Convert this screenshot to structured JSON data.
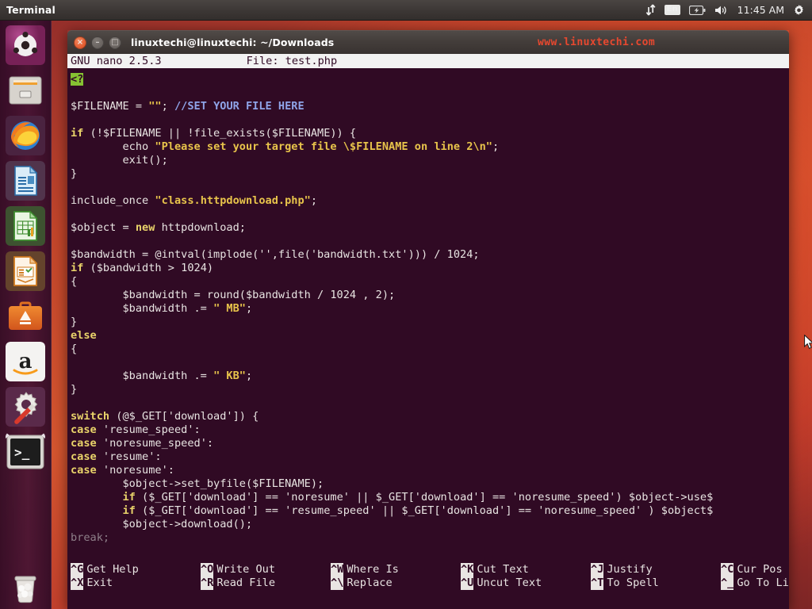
{
  "top_panel": {
    "app_title": "Terminal",
    "indicators": [
      {
        "name": "network-updown-icon",
        "label": "↕"
      },
      {
        "name": "keyboard-layout-indicator",
        "label": "En"
      },
      {
        "name": "battery-icon",
        "label": "battery"
      },
      {
        "name": "volume-icon",
        "label": "volume"
      },
      {
        "name": "clock-indicator",
        "label": "11:45 AM"
      },
      {
        "name": "system-menu-gear-icon",
        "label": "gear"
      }
    ],
    "clock": "11:45 AM",
    "keyboard_layout": "En"
  },
  "launcher": {
    "items": [
      {
        "name": "dash-home",
        "label": "Ubuntu Dash Home",
        "icon": "ubuntu-logo-icon",
        "running": false
      },
      {
        "name": "files",
        "label": "Files",
        "icon": "file-manager-icon",
        "running": false
      },
      {
        "name": "firefox",
        "label": "Firefox Web Browser",
        "icon": "firefox-icon",
        "running": false
      },
      {
        "name": "writer",
        "label": "LibreOffice Writer",
        "icon": "libreoffice-writer-icon",
        "running": false
      },
      {
        "name": "calc",
        "label": "LibreOffice Calc",
        "icon": "libreoffice-calc-icon",
        "running": false
      },
      {
        "name": "impress",
        "label": "LibreOffice Impress",
        "icon": "libreoffice-impress-icon",
        "running": false
      },
      {
        "name": "software-center",
        "label": "Ubuntu Software",
        "icon": "software-center-icon",
        "running": false
      },
      {
        "name": "amazon",
        "label": "Amazon",
        "icon": "amazon-icon",
        "running": false
      },
      {
        "name": "system-settings",
        "label": "System Settings",
        "icon": "system-settings-icon",
        "running": false
      },
      {
        "name": "terminal",
        "label": "Terminal",
        "icon": "terminal-icon",
        "running": true
      },
      {
        "name": "trash",
        "label": "Trash",
        "icon": "trash-icon",
        "running": false
      }
    ]
  },
  "window": {
    "title": "linuxtechi@linuxtechi: ~/Downloads",
    "watermark": "www.linuxtechi.com",
    "close_label": "×",
    "minimize_label": "–",
    "maximize_label": "□"
  },
  "nano": {
    "version": "GNU nano 2.5.3",
    "file_label": "File: test.php",
    "help": [
      [
        {
          "key": "^G",
          "label": "Get Help"
        },
        {
          "key": "^O",
          "label": "Write Out"
        },
        {
          "key": "^W",
          "label": "Where Is"
        },
        {
          "key": "^K",
          "label": "Cut Text"
        },
        {
          "key": "^J",
          "label": "Justify"
        },
        {
          "key": "^C",
          "label": "Cur Pos"
        }
      ],
      [
        {
          "key": "^X",
          "label": "Exit"
        },
        {
          "key": "^R",
          "label": "Read File"
        },
        {
          "key": "^\\",
          "label": "Replace"
        },
        {
          "key": "^U",
          "label": "Uncut Text"
        },
        {
          "key": "^T",
          "label": "To Spell"
        },
        {
          "key": "^_",
          "label": "Go To Line"
        }
      ]
    ]
  },
  "editor": {
    "lines": [
      [
        {
          "t": "<?",
          "c": "phptag"
        }
      ],
      [],
      [
        {
          "t": "$FILENAME = ",
          "c": "plain"
        },
        {
          "t": "\"\"",
          "c": "str"
        },
        {
          "t": "; ",
          "c": "plain"
        },
        {
          "t": "//SET YOUR FILE HERE",
          "c": "cmt"
        }
      ],
      [],
      [
        {
          "t": "if",
          "c": "kw"
        },
        {
          "t": " (!$FILENAME || !file_exists($FILENAME)) {",
          "c": "plain"
        }
      ],
      [
        {
          "t": "        echo ",
          "c": "plain"
        },
        {
          "t": "\"Please set your target file \\$FILENAME on line 2\\n\"",
          "c": "str"
        },
        {
          "t": ";",
          "c": "plain"
        }
      ],
      [
        {
          "t": "        exit();",
          "c": "plain"
        }
      ],
      [
        {
          "t": "}",
          "c": "plain"
        }
      ],
      [],
      [
        {
          "t": "include_once ",
          "c": "plain"
        },
        {
          "t": "\"class.httpdownload.php\"",
          "c": "str"
        },
        {
          "t": ";",
          "c": "plain"
        }
      ],
      [],
      [
        {
          "t": "$object = ",
          "c": "plain"
        },
        {
          "t": "new",
          "c": "kw"
        },
        {
          "t": " httpdownload;",
          "c": "plain"
        }
      ],
      [],
      [
        {
          "t": "$bandwidth = @intval(implode('',file('bandwidth.txt'))) / 1024;",
          "c": "plain"
        }
      ],
      [
        {
          "t": "if",
          "c": "kw"
        },
        {
          "t": " ($bandwidth > 1024)",
          "c": "plain"
        }
      ],
      [
        {
          "t": "{",
          "c": "plain"
        }
      ],
      [
        {
          "t": "        $bandwidth = round($bandwidth / 1024 , 2);",
          "c": "plain"
        }
      ],
      [
        {
          "t": "        $bandwidth .= ",
          "c": "plain"
        },
        {
          "t": "\" MB\"",
          "c": "str"
        },
        {
          "t": ";",
          "c": "plain"
        }
      ],
      [
        {
          "t": "}",
          "c": "plain"
        }
      ],
      [
        {
          "t": "else",
          "c": "kw"
        }
      ],
      [
        {
          "t": "{",
          "c": "plain"
        }
      ],
      [],
      [
        {
          "t": "        $bandwidth .= ",
          "c": "plain"
        },
        {
          "t": "\" KB\"",
          "c": "str"
        },
        {
          "t": ";",
          "c": "plain"
        }
      ],
      [
        {
          "t": "}",
          "c": "plain"
        }
      ],
      [],
      [
        {
          "t": "switch",
          "c": "kw"
        },
        {
          "t": " (@$_GET['download']) {",
          "c": "plain"
        }
      ],
      [
        {
          "t": "case",
          "c": "kw"
        },
        {
          "t": " 'resume_speed':",
          "c": "plain"
        }
      ],
      [
        {
          "t": "case",
          "c": "kw"
        },
        {
          "t": " 'noresume_speed':",
          "c": "plain"
        }
      ],
      [
        {
          "t": "case",
          "c": "kw"
        },
        {
          "t": " 'resume':",
          "c": "plain"
        }
      ],
      [
        {
          "t": "case",
          "c": "kw"
        },
        {
          "t": " 'noresume':",
          "c": "plain"
        }
      ],
      [
        {
          "t": "        $object->set_byfile($FILENAME);",
          "c": "plain"
        }
      ],
      [
        {
          "t": "        ",
          "c": "plain"
        },
        {
          "t": "if",
          "c": "kw"
        },
        {
          "t": " ($_GET['download'] == 'noresume' || $_GET['download'] == 'noresume_speed') $object->use$",
          "c": "plain"
        }
      ],
      [
        {
          "t": "        ",
          "c": "plain"
        },
        {
          "t": "if",
          "c": "kw"
        },
        {
          "t": " ($_GET['download'] == 'resume_speed' || $_GET['download'] == 'noresume_speed' ) $object$",
          "c": "plain"
        }
      ],
      [
        {
          "t": "        $object->download();",
          "c": "plain"
        }
      ],
      [
        {
          "t": "break;",
          "c": "dim"
        }
      ]
    ]
  },
  "colors": {
    "terminal_bg": "#300a24",
    "keyword": "#e9d36a",
    "string": "#e8c44b",
    "comment": "#8fa4e8",
    "php_tag_bg": "#86c232",
    "watermark": "#e8482f",
    "panel_bg": "#3d3836",
    "launcher_bg": "#3e1034"
  }
}
